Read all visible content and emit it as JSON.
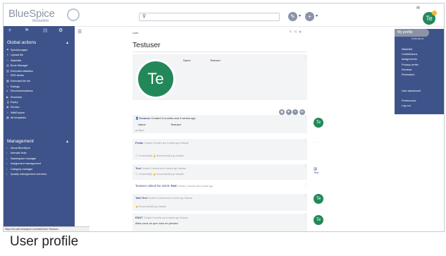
{
  "app": {
    "logo_text": "BlueSpice",
    "logo_sub": "MediaWiki"
  },
  "search": {
    "placeholder": ""
  },
  "top_tiny": "✉",
  "sidebar": {
    "global_title": "Global actions",
    "global_items": [
      "Special pages",
      "Upload file",
      "Watchlist",
      "Book Manager",
      "Extended statistics",
      "RSS feeder",
      "Extended file list",
      "Ratings",
      "Recommendations",
      "Reminder",
      "Expiry",
      "Review",
      "WikiExplore",
      "All templates"
    ],
    "mgmt_title": "Management",
    "mgmt_items": [
      "About BlueSpice",
      "Interwiki links",
      "Namespace manager",
      "Assignment management",
      "Category manager",
      "Quality management overview"
    ]
  },
  "status_url": "https://en.wiki.bluespice.com/wiki/User:Testuser",
  "breadcrumb": "User",
  "page_title": "Testuser",
  "profile": {
    "name_key": "Name",
    "name_value": "Testuser",
    "avatar_initials": "Te"
  },
  "feed": {
    "card1": {
      "user": "Testuser",
      "meta": "Created 3 months and 4 weeks ago",
      "name_key": "Name",
      "name_value": "Testuser",
      "footer": "Watch"
    },
    "card2": {
      "title": "Probe",
      "meta": "Created 3 months and 4 weeks ago Testuser",
      "a1": "Comments(0)",
      "a2": "Recommend(0)",
      "a3": "Unwatch"
    },
    "card3": {
      "title": "Test",
      "meta": "Created 3 months and 4 weeks ago Testuser",
      "a1": "Comments(0)",
      "a2": "Recommend(0)",
      "a3": "Unwatch",
      "img": "Test"
    },
    "card4": {
      "text_pre": "Testuser edited the article",
      "link": "Test",
      "meta": "Created 3 months and 4 weeks ago"
    },
    "card5": {
      "title": "Talk:Test",
      "meta": "Created 3 months and 4 weeks ago Testuser",
      "a2": "Recommend(0)",
      "a3": "Unwatch"
    },
    "card6": {
      "title": "ESDT",
      "meta": "Created 3 months and 4 weeks ago Testuser",
      "body": "Allez-vous ce que vous en pensez"
    }
  },
  "user_menu": {
    "header": "My profile",
    "sub": "Notifications",
    "items": [
      "Watchlist",
      "Contributions",
      "Assignments",
      "Privacy center",
      "Reviews",
      "Reminders"
    ],
    "items2": [
      "User dashboard"
    ],
    "items3": [
      "Preferences",
      "Log out"
    ]
  },
  "caption": "User profile"
}
